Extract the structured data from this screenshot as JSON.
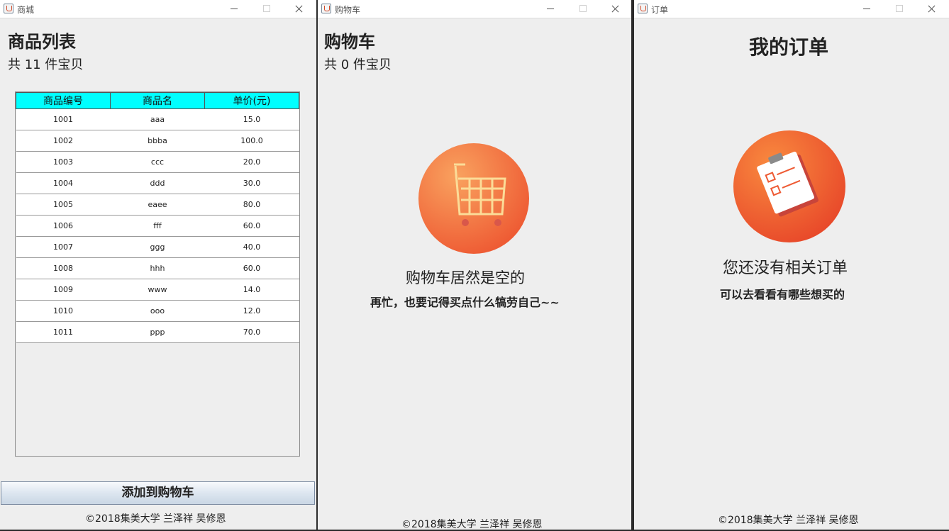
{
  "shop": {
    "window_title": "商城",
    "heading": "商品列表",
    "count_text": "共 11 件宝贝",
    "columns": [
      "商品编号",
      "商品名",
      "单价(元)"
    ],
    "rows": [
      [
        "1001",
        "aaa",
        "15.0"
      ],
      [
        "1002",
        "bbba",
        "100.0"
      ],
      [
        "1003",
        "ccc",
        "20.0"
      ],
      [
        "1004",
        "ddd",
        "30.0"
      ],
      [
        "1005",
        "eaee",
        "80.0"
      ],
      [
        "1006",
        "fff",
        "60.0"
      ],
      [
        "1007",
        "ggg",
        "40.0"
      ],
      [
        "1008",
        "hhh",
        "60.0"
      ],
      [
        "1009",
        "www",
        "14.0"
      ],
      [
        "1010",
        "ooo",
        "12.0"
      ],
      [
        "1011",
        "ppp",
        "70.0"
      ]
    ],
    "add_button": "添加到购物车",
    "footer": "©2018集美大学 兰泽祥 吴修恩"
  },
  "cart": {
    "window_title": "购物车",
    "heading": "购物车",
    "count_text": "共 0 件宝贝",
    "empty_title": "购物车居然是空的",
    "empty_subtitle": "再忙，也要记得买点什么犒劳自己~~",
    "footer": "©2018集美大学 兰泽祥 吴修恩"
  },
  "orders": {
    "window_title": "订单",
    "heading": "我的订单",
    "empty_title": "您还没有相关订单",
    "empty_subtitle": "可以去看看有哪些想买的",
    "footer": "©2018集美大学 兰泽祥 吴修恩"
  },
  "colors": {
    "table_header": "#00ffff",
    "illustration_orange": "#f26a3a",
    "window_bg": "#eeeeee"
  }
}
